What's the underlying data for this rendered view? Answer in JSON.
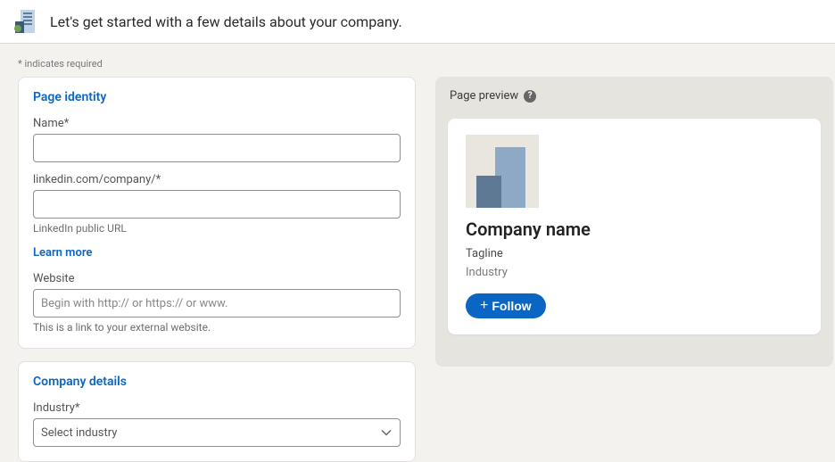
{
  "header": {
    "title": "Let's get started with a few details about your company."
  },
  "required_note": "*  indicates required",
  "page_identity": {
    "title": "Page identity",
    "name_label": "Name*",
    "name_value": "",
    "url_label": "linkedin.com/company/*",
    "url_value": "",
    "url_helper": "LinkedIn public URL",
    "learn_more": "Learn more",
    "website_label": "Website",
    "website_placeholder": "Begin with http:// or https:// or www.",
    "website_value": "",
    "website_helper": "This is a link to your external website."
  },
  "company_details": {
    "title": "Company details",
    "industry_label": "Industry*",
    "industry_placeholder": "Select industry"
  },
  "preview": {
    "header": "Page preview",
    "company_name": "Company name",
    "tagline": "Tagline",
    "industry": "Industry",
    "follow_label": "Follow"
  }
}
